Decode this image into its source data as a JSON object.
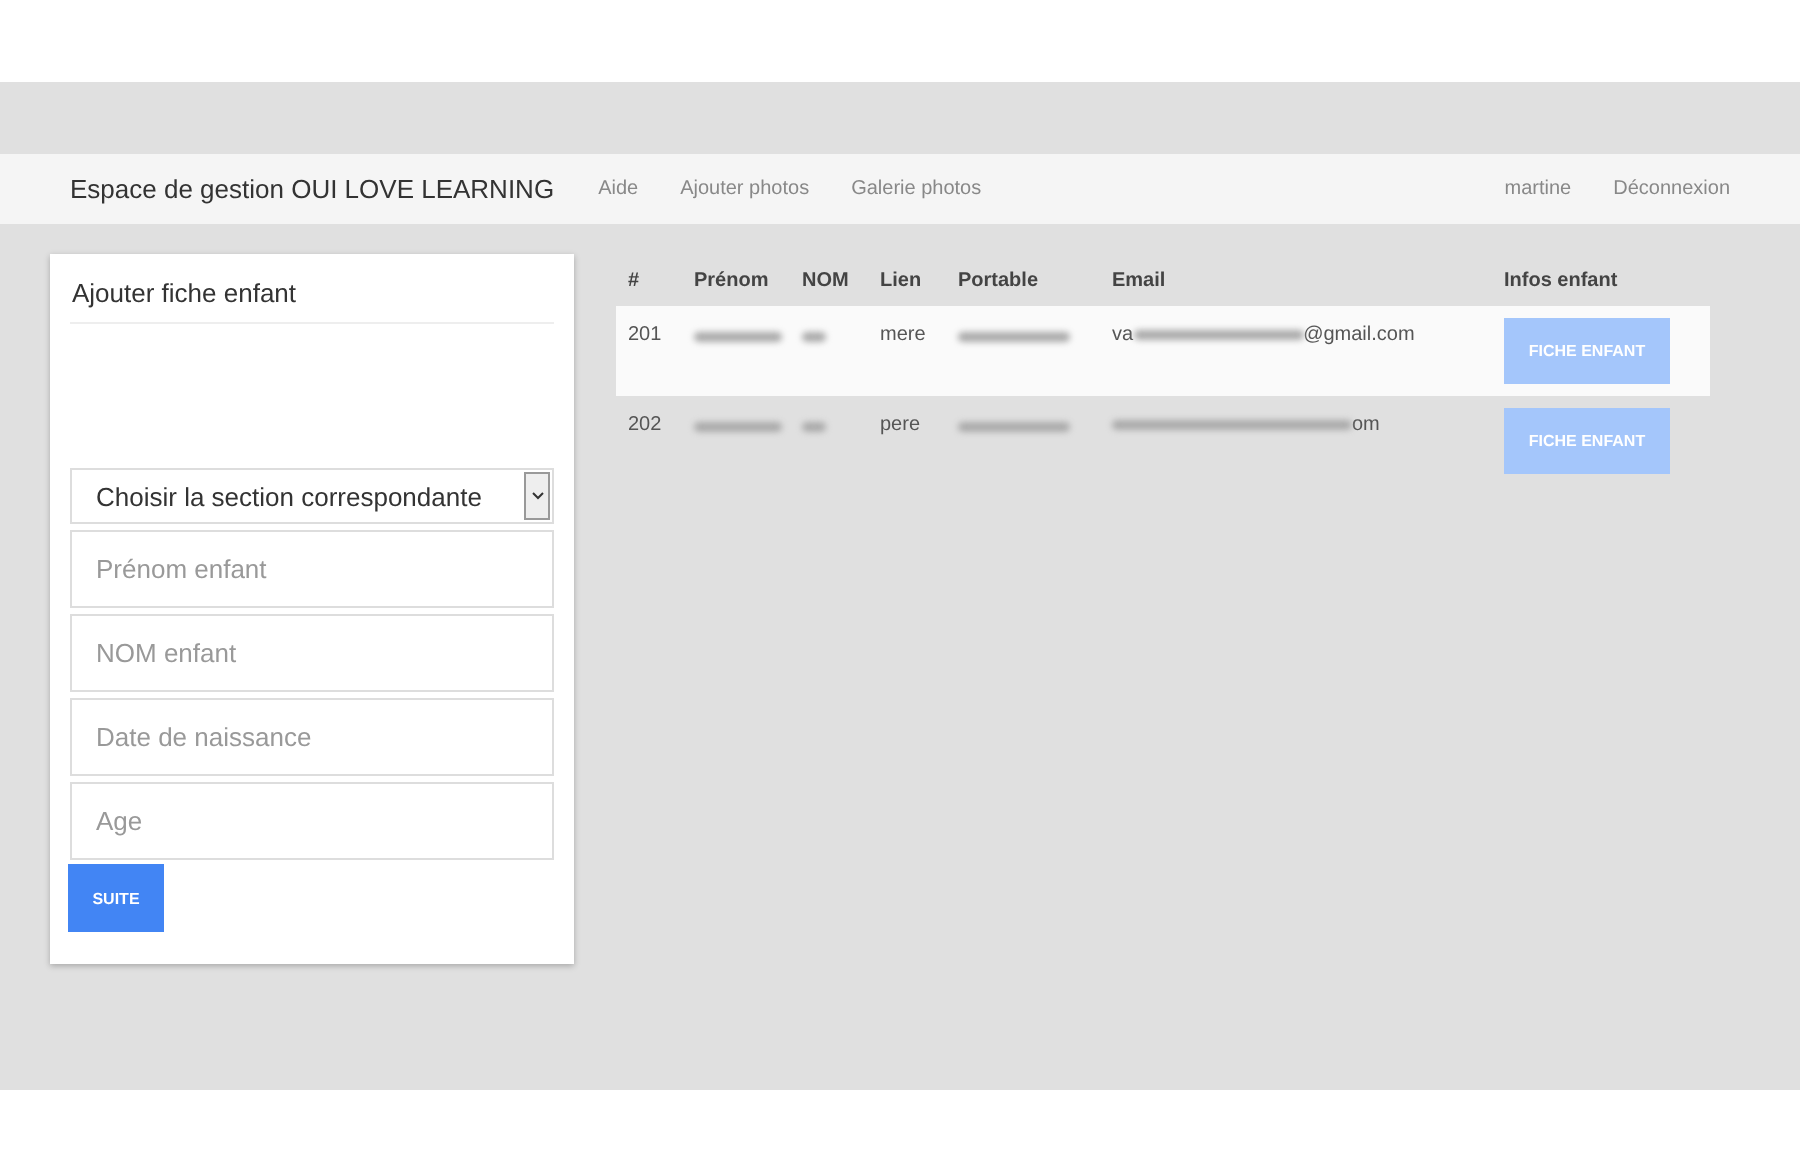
{
  "navbar": {
    "brand": "Espace de gestion OUI LOVE LEARNING",
    "links": [
      "Aide",
      "Ajouter photos",
      "Galerie photos"
    ],
    "user": "martine",
    "logout": "Déconnexion"
  },
  "form": {
    "title": "Ajouter fiche enfant",
    "select": "Choisir la section correspondante",
    "fields": [
      {
        "placeholder": "Prénom enfant"
      },
      {
        "placeholder": "NOM enfant"
      },
      {
        "placeholder": "Date de naissance"
      },
      {
        "placeholder": "Age"
      }
    ],
    "submit": "SUITE"
  },
  "table": {
    "columns": [
      "#",
      "Prénom",
      "NOM",
      "Lien",
      "Portable",
      "Email",
      "Infos enfant"
    ],
    "rows": [
      {
        "id": "201",
        "lien": "mere",
        "email_start": "va",
        "email_end": "@gmail.com",
        "button": "FICHE ENFANT",
        "selected": true
      },
      {
        "id": "202",
        "lien": "pere",
        "email_start": "",
        "email_end": "om",
        "button": "FICHE ENFANT",
        "selected": false
      }
    ]
  }
}
